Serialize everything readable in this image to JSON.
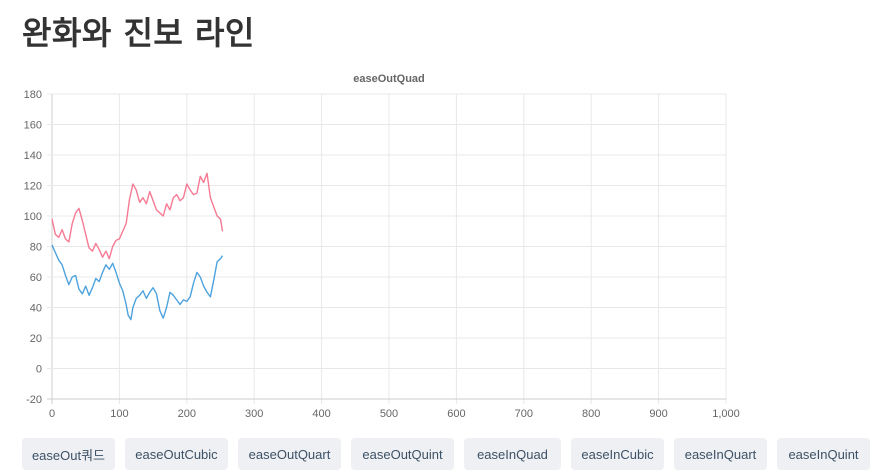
{
  "page": {
    "title": "완화와 진보 라인"
  },
  "chart_data": {
    "type": "line",
    "title": "easeOutQuad",
    "xlabel": "",
    "ylabel": "",
    "xlim": [
      0,
      1000
    ],
    "ylim": [
      -20,
      180
    ],
    "x_ticks": [
      "0",
      "100",
      "200",
      "300",
      "400",
      "500",
      "600",
      "700",
      "800",
      "900",
      "1,000"
    ],
    "y_ticks": [
      "-20",
      "0",
      "20",
      "40",
      "60",
      "80",
      "100",
      "120",
      "140",
      "160",
      "180"
    ],
    "grid": true,
    "legend": "none",
    "series": [
      {
        "color": "#f67a94",
        "points": [
          [
            0,
            98
          ],
          [
            5,
            88
          ],
          [
            10,
            86
          ],
          [
            15,
            91
          ],
          [
            20,
            85
          ],
          [
            25,
            83
          ],
          [
            30,
            95
          ],
          [
            35,
            102
          ],
          [
            40,
            105
          ],
          [
            45,
            97
          ],
          [
            50,
            88
          ],
          [
            55,
            79
          ],
          [
            60,
            77
          ],
          [
            65,
            82
          ],
          [
            70,
            78
          ],
          [
            75,
            73
          ],
          [
            80,
            77
          ],
          [
            85,
            72
          ],
          [
            90,
            80
          ],
          [
            95,
            84
          ],
          [
            100,
            85
          ],
          [
            105,
            90
          ],
          [
            110,
            95
          ],
          [
            115,
            111
          ],
          [
            120,
            121
          ],
          [
            125,
            117
          ],
          [
            130,
            109
          ],
          [
            135,
            112
          ],
          [
            140,
            108
          ],
          [
            145,
            116
          ],
          [
            150,
            110
          ],
          [
            155,
            104
          ],
          [
            160,
            102
          ],
          [
            165,
            100
          ],
          [
            170,
            108
          ],
          [
            175,
            104
          ],
          [
            180,
            112
          ],
          [
            185,
            114
          ],
          [
            190,
            110
          ],
          [
            195,
            112
          ],
          [
            200,
            121
          ],
          [
            205,
            117
          ],
          [
            210,
            114
          ],
          [
            215,
            115
          ],
          [
            220,
            126
          ],
          [
            225,
            122
          ],
          [
            230,
            128
          ],
          [
            235,
            112
          ],
          [
            240,
            106
          ],
          [
            245,
            100
          ],
          [
            250,
            98
          ],
          [
            253,
            90
          ]
        ]
      },
      {
        "color": "#4da3dd",
        "points": [
          [
            0,
            81
          ],
          [
            5,
            76
          ],
          [
            10,
            71
          ],
          [
            15,
            68
          ],
          [
            20,
            61
          ],
          [
            25,
            55
          ],
          [
            30,
            60
          ],
          [
            35,
            61
          ],
          [
            40,
            52
          ],
          [
            45,
            49
          ],
          [
            50,
            54
          ],
          [
            55,
            48
          ],
          [
            60,
            53
          ],
          [
            65,
            59
          ],
          [
            70,
            57
          ],
          [
            75,
            63
          ],
          [
            80,
            68
          ],
          [
            85,
            65
          ],
          [
            90,
            69
          ],
          [
            95,
            63
          ],
          [
            100,
            56
          ],
          [
            105,
            51
          ],
          [
            110,
            42
          ],
          [
            113,
            35
          ],
          [
            117,
            32
          ],
          [
            120,
            40
          ],
          [
            125,
            46
          ],
          [
            130,
            48
          ],
          [
            135,
            51
          ],
          [
            140,
            46
          ],
          [
            145,
            50
          ],
          [
            150,
            53
          ],
          [
            155,
            49
          ],
          [
            160,
            38
          ],
          [
            165,
            33
          ],
          [
            170,
            40
          ],
          [
            175,
            50
          ],
          [
            180,
            48
          ],
          [
            185,
            45
          ],
          [
            190,
            42
          ],
          [
            195,
            45
          ],
          [
            200,
            44
          ],
          [
            205,
            47
          ],
          [
            210,
            56
          ],
          [
            215,
            63
          ],
          [
            220,
            60
          ],
          [
            225,
            54
          ],
          [
            230,
            50
          ],
          [
            235,
            47
          ],
          [
            240,
            58
          ],
          [
            245,
            70
          ],
          [
            250,
            72
          ],
          [
            253,
            74
          ]
        ]
      }
    ]
  },
  "buttons": [
    "easeOut쿼드",
    "easeOutCubic",
    "easeOutQuart",
    "easeOutQuint",
    "easeInQuad",
    "easeInCubic",
    "easeInQuart",
    "easeInQuint"
  ]
}
